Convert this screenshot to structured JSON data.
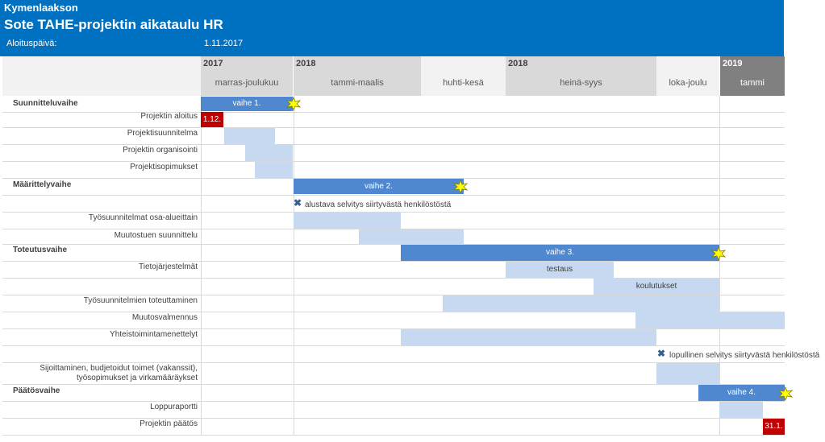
{
  "header": {
    "company": "Kymenlaakson",
    "title": "Sote TAHE-projektin aikataulu HR",
    "start_label": "Aloituspäivä:",
    "start_value": "1.11.2017"
  },
  "timeline_header": {
    "year_2017": "2017",
    "year_2018a": "2018",
    "year_2018b": "2018",
    "year_2019": "2019",
    "p1": "marras-joulukuu",
    "p2": "tammi-maalis",
    "p3": "huhti-kesä",
    "p4": "heinä-syys",
    "p5": "loka-joulu",
    "p6": "tammi"
  },
  "rows": {
    "suunnitteluvaihe": "Suunnitteluvaihe",
    "projektin_aloitus": "Projektin aloitus",
    "projektisuunnitelma": "Projektisuunnitelma",
    "projektin_organisointi": "Projektin organisointi",
    "projektisopimukset": "Projektisopimukset",
    "maarittelyvaihe": "Määrittelyvaihe",
    "tyosuunnitelmat": "Työsuunnitelmat osa-alueittain",
    "muutostuen": "Muutostuen suunnittelu",
    "toteutusvaihe": "Toteutusvaihe",
    "tietojarjestelmat": "Tietojärjestelmät",
    "tyosuunnitelmien": "Työsuunnitelmien toteuttaminen",
    "muutosvalmennus": "Muutosvalmennus",
    "yhteistoiminta": "Yhteistoimintamenettelyt",
    "sijoittaminen_1": "Sijoittaminen, budjetoidut toimet (vakanssit),",
    "sijoittaminen_2": "työsopimukset ja virkamääräykset",
    "paatosvaihe": "Päätösvaihe",
    "loppuraportti": "Loppuraportti",
    "projektin_paatos": "Projektin päätös"
  },
  "bars": {
    "vaihe1": "vaihe 1.",
    "vaihe2": "vaihe 2.",
    "vaihe3": "vaihe 3.",
    "vaihe4": "vaihe 4.",
    "testaus": "testaus",
    "koulutukset": "koulutukset",
    "start_marker": "1.12.",
    "end_marker": "31.1."
  },
  "notes": {
    "alustava": "alustava selvitys siirtyvästä henkilöstöstä",
    "lopullinen": "lopullinen selvitys siirtyvästä henkilöstöstä"
  },
  "colors": {
    "header_blue": "#0070c0",
    "phase_bar": "#4f88cf",
    "task_bar": "#c6d9f1",
    "marker_red": "#c00000",
    "star_yellow": "#ffff00"
  }
}
